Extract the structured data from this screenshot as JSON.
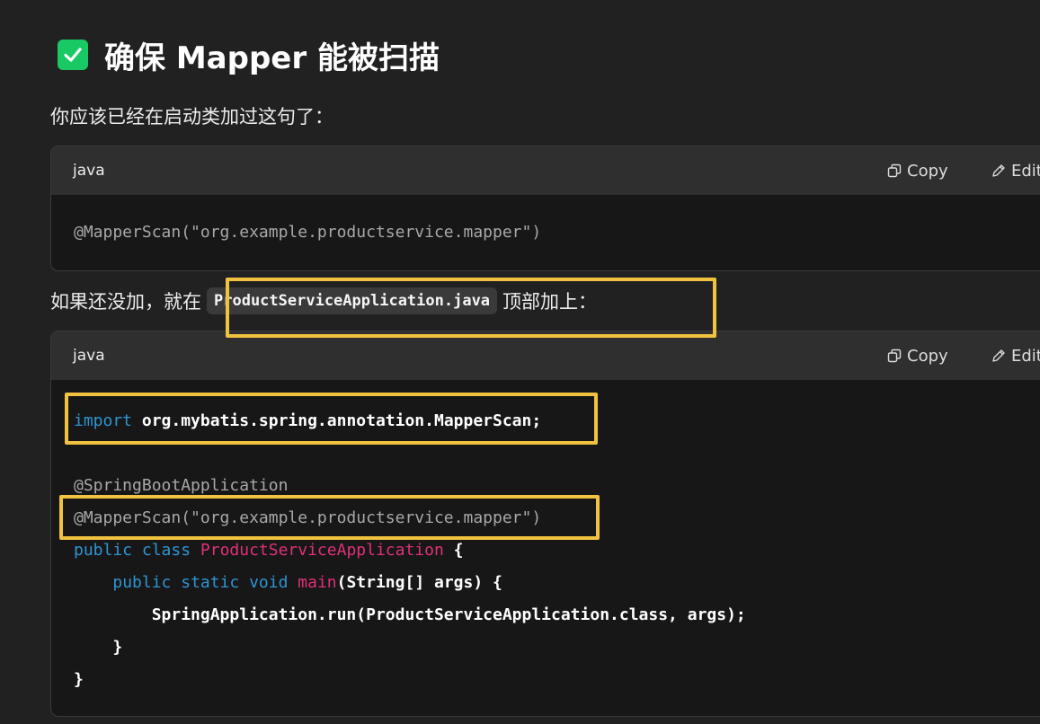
{
  "heading": {
    "text": "确保 Mapper 能被扫描"
  },
  "intro_text": "你应该已经在启动类加过这句了：",
  "block1": {
    "lang": "java",
    "copy_label": "Copy",
    "edit_label": "Edit",
    "code": "@MapperScan(\"org.example.productservice.mapper\")"
  },
  "para2": {
    "before": "如果还没加，就在",
    "inline_code": "ProductServiceApplication.java",
    "after": "顶部加上："
  },
  "block2": {
    "lang": "java",
    "copy_label": "Copy",
    "edit_label": "Edit",
    "tokens": {
      "import_kw": "import",
      "import_path": " org.mybatis.spring.annotation.MapperScan;",
      "anno1": "@SpringBootApplication",
      "anno2": "@MapperScan(\"org.example.productservice.mapper\")",
      "public1": "public",
      "class_kw": " class ",
      "class_name": "ProductServiceApplication",
      "brace_open1": " {",
      "indent1": "    ",
      "public2": "public",
      "static_kw": " static",
      "void_kw": " void",
      "main_fn": " main",
      "main_args": "(String[] args) {",
      "run_line": "        SpringApplication.run(ProductServiceApplication.class, args);",
      "brace_close_inner": "    }",
      "brace_close_outer": "}"
    }
  },
  "colors": {
    "background": "#212121",
    "code_background": "#171717",
    "header_background": "#2f2f2f",
    "highlight_box": "#f0c240",
    "keyword": "#2e95d3",
    "class_name": "#df3079",
    "check_badge": "#18c964"
  },
  "icons": {
    "check": "check-box-icon",
    "copy": "copy-icon",
    "edit": "edit-icon"
  }
}
